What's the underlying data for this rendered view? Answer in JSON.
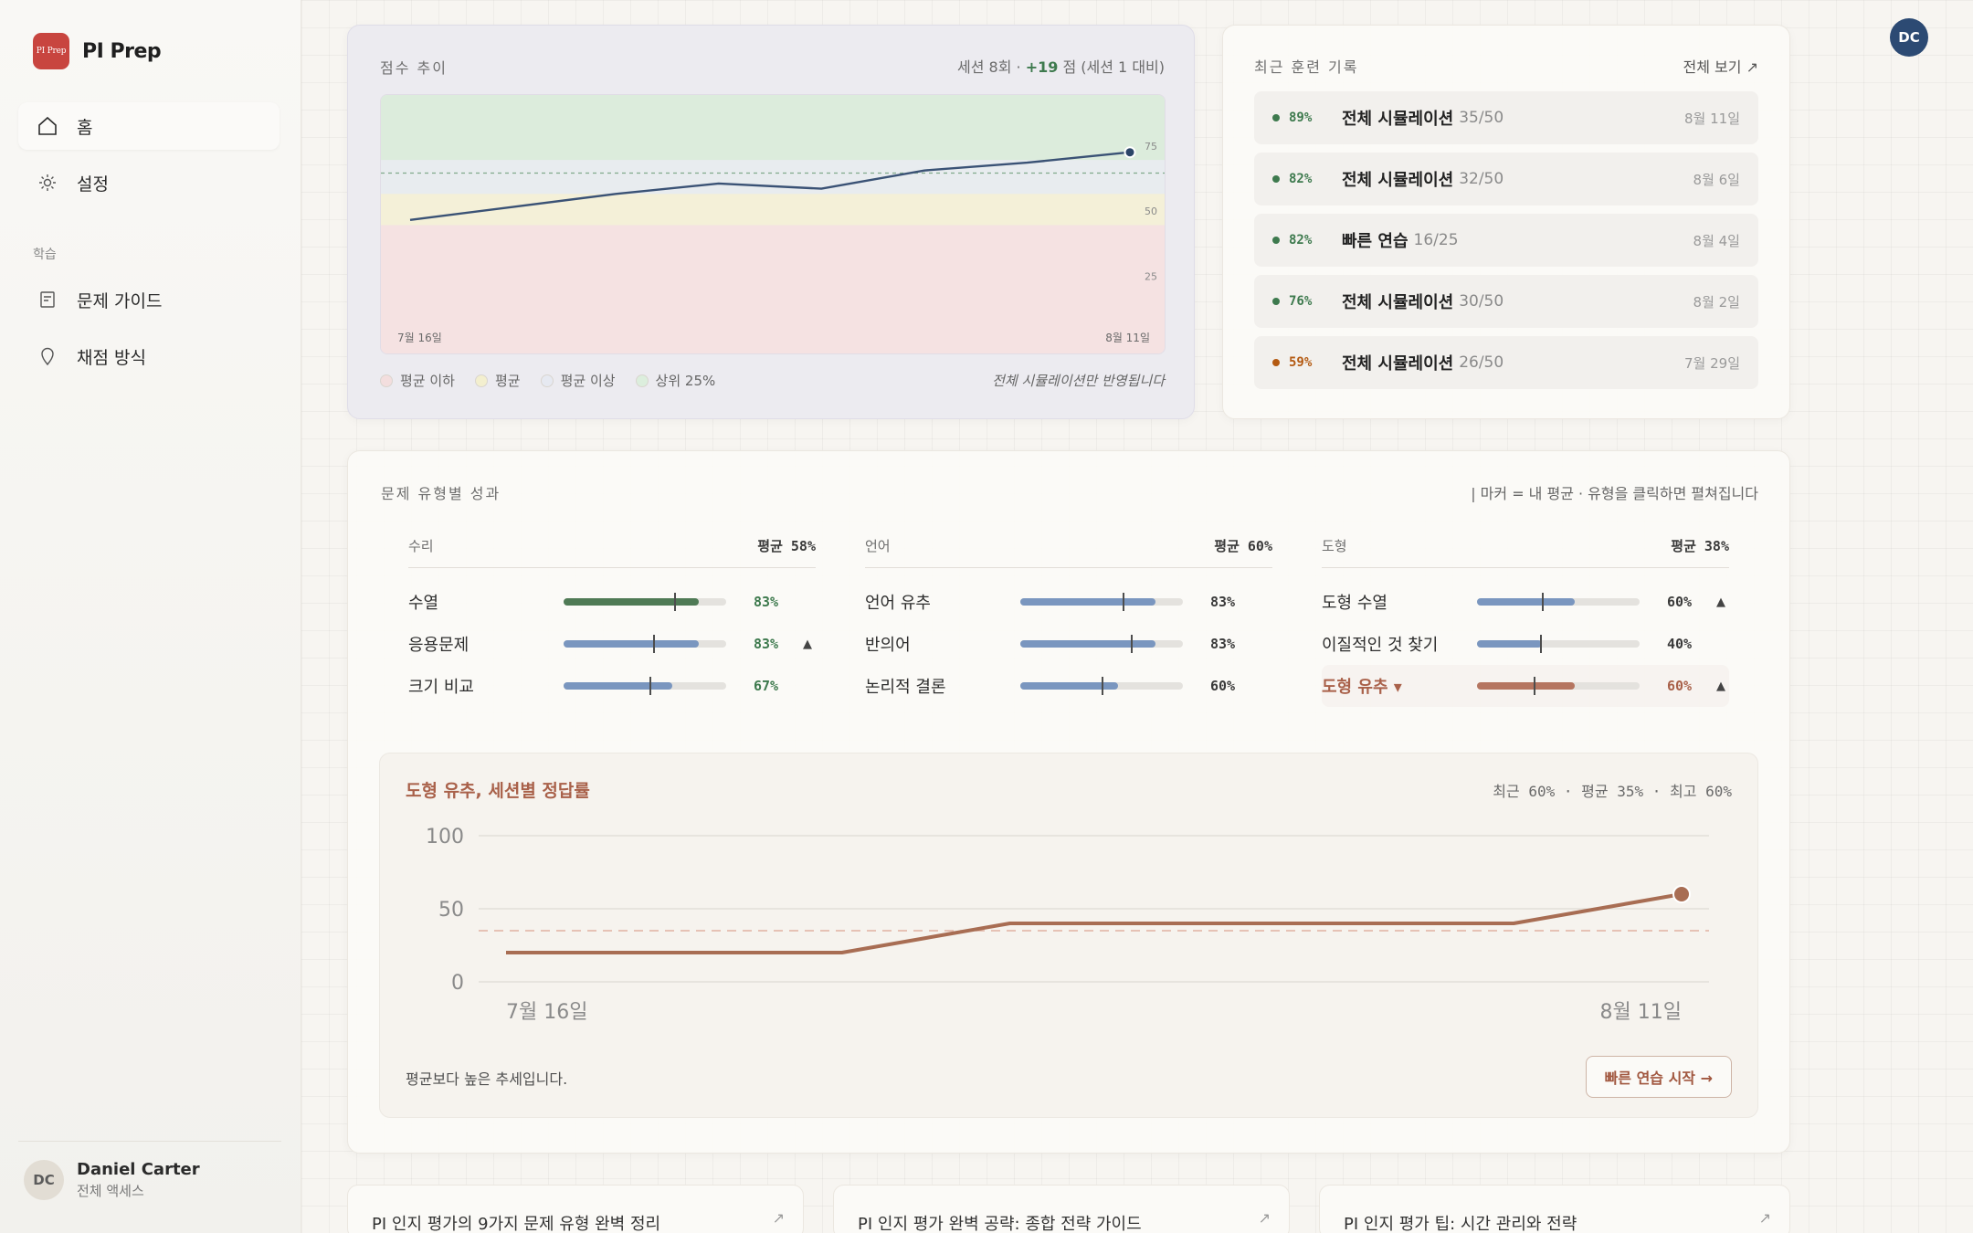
{
  "brand": {
    "logo_text": "PI Prep",
    "name": "PI Prep"
  },
  "sidebar": {
    "nav": [
      {
        "label": "홈",
        "icon": "home-icon",
        "active": true
      },
      {
        "label": "설정",
        "icon": "gear-icon",
        "active": false
      }
    ],
    "section_label": "학습",
    "learn": [
      {
        "label": "문제 가이드",
        "icon": "document-icon"
      },
      {
        "label": "채점 방식",
        "icon": "pin-icon"
      }
    ],
    "user": {
      "initials": "DC",
      "name": "Daniel Carter",
      "subtitle": "전체 액세스"
    }
  },
  "header": {
    "avatar_initials": "DC"
  },
  "trend": {
    "title": "점수 추이",
    "summary_prefix": "세션 8회 · ",
    "summary_delta": "+19",
    "summary_suffix": " 점 (세션 1 대비)",
    "x_start": "7월 16일",
    "x_end": "8월 11일",
    "band_labels": [
      "75",
      "50",
      "25"
    ],
    "legend": [
      {
        "label": "평균 이하",
        "color": "#f3dede"
      },
      {
        "label": "평균",
        "color": "#f3efcf"
      },
      {
        "label": "평균 이상",
        "color": "#e6e9f1"
      },
      {
        "label": "상위 25%",
        "color": "#dceedd"
      }
    ],
    "note": "전체 시뮬레이션만 반영됩니다",
    "chart_data": {
      "type": "line",
      "x": [
        "7월 16일",
        "",
        "",
        "",
        "",
        "",
        "",
        "8월 11일"
      ],
      "series": [
        {
          "values": [
            52,
            57,
            62,
            66,
            64,
            71,
            74,
            78
          ]
        }
      ],
      "reference_line": 70,
      "ylim": [
        0,
        100
      ],
      "bands": {
        "below_avg": [
          0,
          50
        ],
        "avg": [
          50,
          62
        ],
        "above_avg": [
          62,
          75
        ],
        "top25": [
          75,
          100
        ]
      }
    }
  },
  "recent": {
    "title": "최근 훈련 기록",
    "see_all": "전체 보기 ↗",
    "items": [
      {
        "pct": "89%",
        "name": "전체 시뮬레이션",
        "score": "35/50",
        "date": "8월 11일",
        "color": "#3e7a4e"
      },
      {
        "pct": "82%",
        "name": "전체 시뮬레이션",
        "score": "32/50",
        "date": "8월 6일",
        "color": "#3e7a4e"
      },
      {
        "pct": "82%",
        "name": "빠른 연습",
        "score": "16/25",
        "date": "8월 4일",
        "color": "#3e7a4e"
      },
      {
        "pct": "76%",
        "name": "전체 시뮬레이션",
        "score": "30/50",
        "date": "8월 2일",
        "color": "#3e7a4e"
      },
      {
        "pct": "59%",
        "name": "전체 시뮬레이션",
        "score": "26/50",
        "date": "7월 29일",
        "color": "#b45a12"
      }
    ]
  },
  "performance": {
    "title": "문제 유형별 성과",
    "hint": "| 마커 = 내 평균 · 유형을 클릭하면 펼쳐집니다",
    "columns": [
      {
        "category": "수리",
        "avg": "평균 58%",
        "rows": [
          {
            "label": "수열",
            "value": "83%",
            "fill": 0.83,
            "marker": 0.68,
            "color": "#4f7a55",
            "value_color": "#3e7a4e",
            "tri": ""
          },
          {
            "label": "응용문제",
            "value": "83%",
            "fill": 0.83,
            "marker": 0.55,
            "color": "#7a96bf",
            "value_color": "#3e7a4e",
            "tri": "▲"
          },
          {
            "label": "크기 비교",
            "value": "67%",
            "fill": 0.67,
            "marker": 0.53,
            "color": "#7a96bf",
            "value_color": "#3e7a4e",
            "tri": ""
          }
        ]
      },
      {
        "category": "언어",
        "avg": "평균 60%",
        "rows": [
          {
            "label": "언어 유추",
            "value": "83%",
            "fill": 0.83,
            "marker": 0.63,
            "color": "#7a96bf",
            "value_color": "#3a3a3a",
            "tri": ""
          },
          {
            "label": "반의어",
            "value": "83%",
            "fill": 0.83,
            "marker": 0.68,
            "color": "#7a96bf",
            "value_color": "#3a3a3a",
            "tri": ""
          },
          {
            "label": "논리적 결론",
            "value": "60%",
            "fill": 0.6,
            "marker": 0.5,
            "color": "#7a96bf",
            "value_color": "#3a3a3a",
            "tri": ""
          }
        ]
      },
      {
        "category": "도형",
        "avg": "평균 38%",
        "rows": [
          {
            "label": "도형 수열",
            "value": "60%",
            "fill": 0.6,
            "marker": 0.4,
            "color": "#7a96bf",
            "value_color": "#3a3a3a",
            "tri": "▲"
          },
          {
            "label": "이질적인 것 찾기",
            "value": "40%",
            "fill": 0.4,
            "marker": 0.39,
            "color": "#7a96bf",
            "value_color": "#3a3a3a",
            "tri": ""
          },
          {
            "label": "도형 유추 ▾",
            "value": "60%",
            "fill": 0.6,
            "marker": 0.35,
            "color": "#b57560",
            "value_color": "#a9614a",
            "tri": "▲",
            "selected": true
          }
        ]
      }
    ],
    "detail": {
      "title": "도형 유추, 세션별 정답률",
      "stats": "최근 60% · 평균 35% · 최고 60%",
      "note": "평균보다 높은 추세입니다.",
      "button": "빠른 연습 시작 →",
      "chart_data": {
        "type": "line",
        "x": [
          "7월 16일",
          "",
          "",
          "",
          "",
          "",
          "",
          "8월 11일"
        ],
        "series": [
          {
            "values": [
              20,
              20,
              20,
              40,
              40,
              40,
              40,
              60
            ]
          }
        ],
        "reference_line": 35,
        "ylim": [
          0,
          100
        ],
        "yticks": [
          "0",
          "50",
          "100"
        ],
        "color": "#a86d53"
      }
    }
  },
  "articles": [
    {
      "title": "PI 인지 평가의 9가지 문제 유형 완벽 정리"
    },
    {
      "title": "PI 인지 평가 완벽 공략: 종합 전략 가이드"
    },
    {
      "title": "PI 인지 평가 팁: 시간 관리와 전략"
    }
  ]
}
